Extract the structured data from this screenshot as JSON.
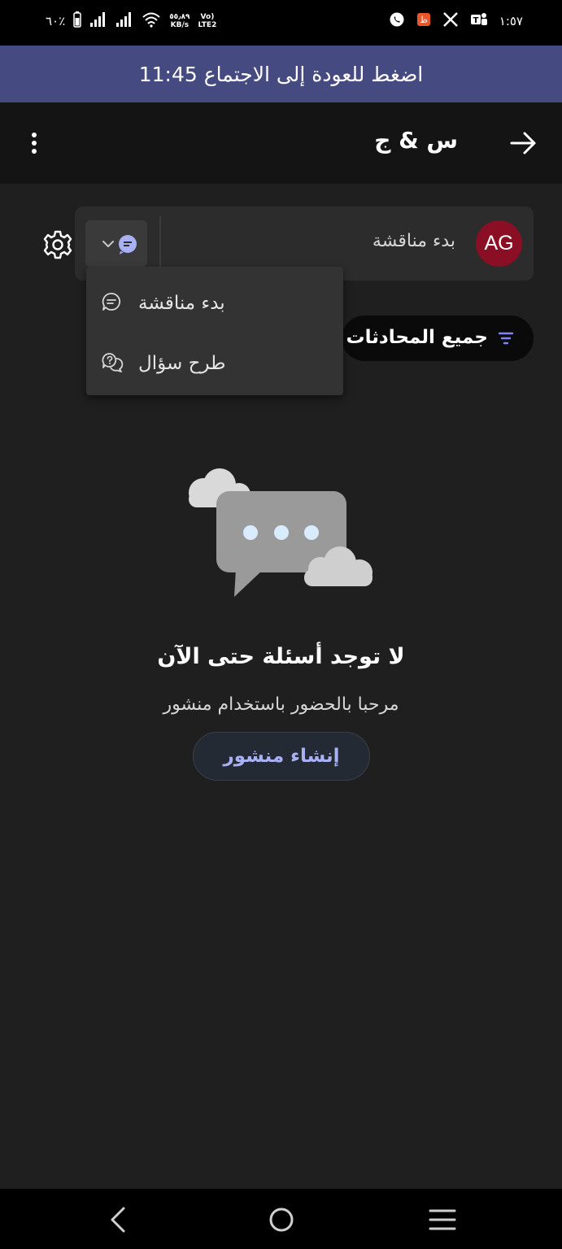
{
  "status_bar": {
    "battery_percent": "٦٠٪",
    "net_speed_value": "٥٥٫٨٩",
    "net_speed_unit": "KB/s",
    "network_top": "Vo)",
    "network_bottom": "LTE2",
    "time": "١:٥٧",
    "notification_icons": [
      "whatsapp-icon",
      "app-notification-icon",
      "x-icon",
      "teams-icon"
    ]
  },
  "banner": {
    "text": "اضغط للعودة إلى الاجتماع 11:45"
  },
  "header": {
    "title": "س & ج"
  },
  "composer": {
    "avatar_initials": "AG",
    "avatar_color": "#8a0f24",
    "input_value": "بدء مناقشة"
  },
  "filter": {
    "label": "جميع المحادثات",
    "icon_color": "#7f85f5"
  },
  "menu": {
    "items": [
      {
        "label": "بدء مناقشة",
        "icon": "discussion-icon"
      },
      {
        "label": "طرح سؤال",
        "icon": "question-icon"
      }
    ]
  },
  "empty_state": {
    "title": "لا توجد أسئلة حتى الآن",
    "subtitle": "مرحبا بالحضور باستخدام منشور",
    "button_label": "إنشاء منشور"
  },
  "colors": {
    "accent": "#a9b1f5",
    "banner": "#454a80",
    "background": "#1f1f1f"
  }
}
